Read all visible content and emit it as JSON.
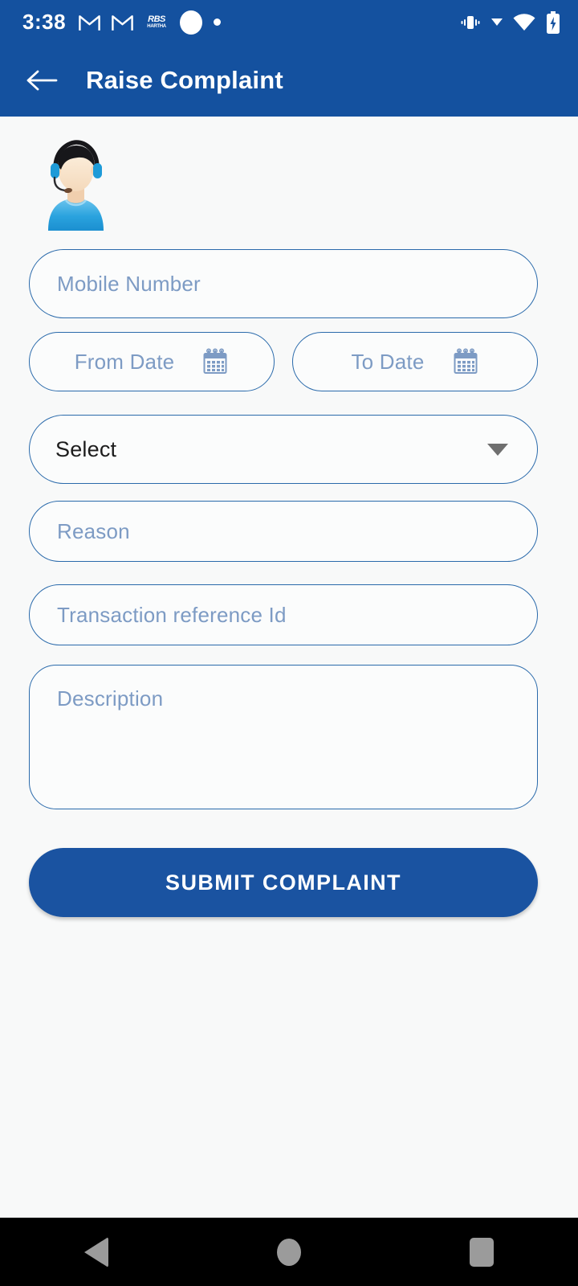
{
  "status_bar": {
    "time": "3:38",
    "left_icons": [
      {
        "name": "gmail-icon-1",
        "glyph": "M"
      },
      {
        "name": "gmail-icon-2",
        "glyph": "M"
      },
      {
        "name": "rbs-hartha-app-icon",
        "glyph_top": "RBS",
        "glyph_bottom": "HARTHA"
      },
      {
        "name": "white-circle-notification-icon",
        "glyph": ""
      },
      {
        "name": "small-dot-notification-icon",
        "glyph": ""
      }
    ],
    "right_icons": [
      {
        "name": "vibrate-mode-icon"
      },
      {
        "name": "caret-down-icon"
      },
      {
        "name": "wifi-icon"
      },
      {
        "name": "battery-charging-icon"
      }
    ]
  },
  "app_bar": {
    "back_label": "←",
    "title": "Raise Complaint",
    "background": "#14519f",
    "text_color": "#ffffff"
  },
  "avatar": {
    "name": "customer-support-agent-avatar",
    "hair_color": "#1a1a1a",
    "skin_color": "#f6dfc6",
    "shirt_color": "#2196d6",
    "headset_color": "#1e9bd8"
  },
  "form": {
    "mobile_number": {
      "placeholder": "Mobile Number",
      "value": ""
    },
    "from_date": {
      "placeholder": "From Date",
      "value": "",
      "icon": "calendar-icon"
    },
    "to_date": {
      "placeholder": "To Date",
      "value": "",
      "icon": "calendar-icon"
    },
    "complaint_type": {
      "selected": "Select",
      "icon": "chevron-down-icon"
    },
    "reason": {
      "placeholder": "Reason",
      "value": ""
    },
    "transaction_reference_id": {
      "placeholder": "Transaction reference Id",
      "value": ""
    },
    "description": {
      "placeholder": "Description",
      "value": ""
    },
    "submit_label": "SUBMIT COMPLAINT"
  },
  "colors": {
    "primary_blue": "#14519f",
    "button_blue": "#1a53a1",
    "field_border": "#2a6aab",
    "placeholder_text": "#7d9bc4",
    "page_background": "#f8f9f9",
    "nav_bar": "#000000"
  },
  "nav_bar": {
    "back": "back-triangle",
    "home": "home-circle",
    "recents": "recents-square"
  }
}
